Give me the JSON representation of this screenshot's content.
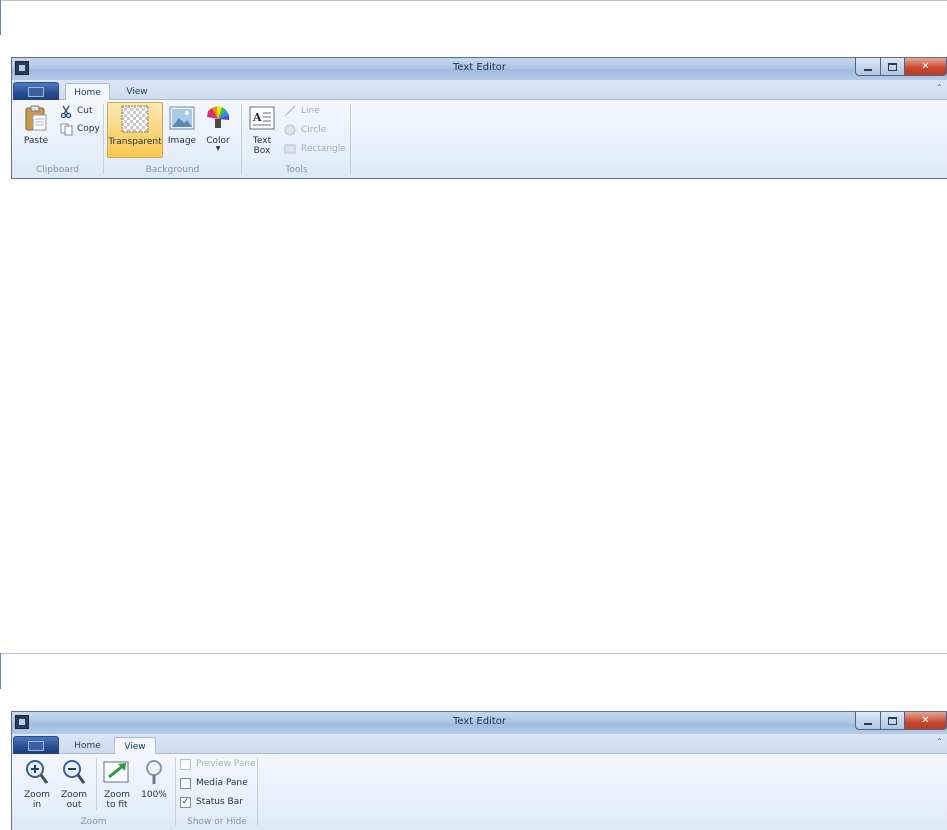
{
  "windows": [
    {
      "title": "Text Editor",
      "tabs": [
        {
          "label": "Home",
          "active": true
        },
        {
          "label": "View",
          "active": false
        }
      ],
      "groups": {
        "clipboard": {
          "label": "Clipboard",
          "paste": "Paste",
          "cut": "Cut",
          "copy": "Copy"
        },
        "background": {
          "label": "Background",
          "transparent": "Transparent",
          "image": "Image",
          "color": "Color"
        },
        "tools": {
          "label": "Tools",
          "textbox_line1": "Text",
          "textbox_line2": "Box",
          "line": "Line",
          "circle": "Circle",
          "rectangle": "Rectangle"
        }
      }
    },
    {
      "title": "Text Editor",
      "tabs": [
        {
          "label": "Home",
          "active": false
        },
        {
          "label": "View",
          "active": true
        }
      ],
      "groups": {
        "zoom": {
          "label": "Zoom",
          "zoom_in_line1": "Zoom",
          "zoom_in_line2": "in",
          "zoom_out_line1": "Zoom",
          "zoom_out_line2": "out",
          "zoom_fit_line1": "Zoom",
          "zoom_fit_line2": "to fit",
          "zoom_100": "100%"
        },
        "show_hide": {
          "label": "Show or Hide",
          "preview_pane": "Preview Pane",
          "media_pane": "Media Pane",
          "status_bar": "Status Bar",
          "preview_checked": false,
          "media_checked": false,
          "status_checked": true,
          "check_glyph": "✓"
        }
      }
    }
  ],
  "icons": {
    "minimize": "minimize-icon",
    "maximize": "maximize-icon",
    "close": "close-icon",
    "close_glyph": "✕",
    "collapse_glyph": "⌃"
  }
}
